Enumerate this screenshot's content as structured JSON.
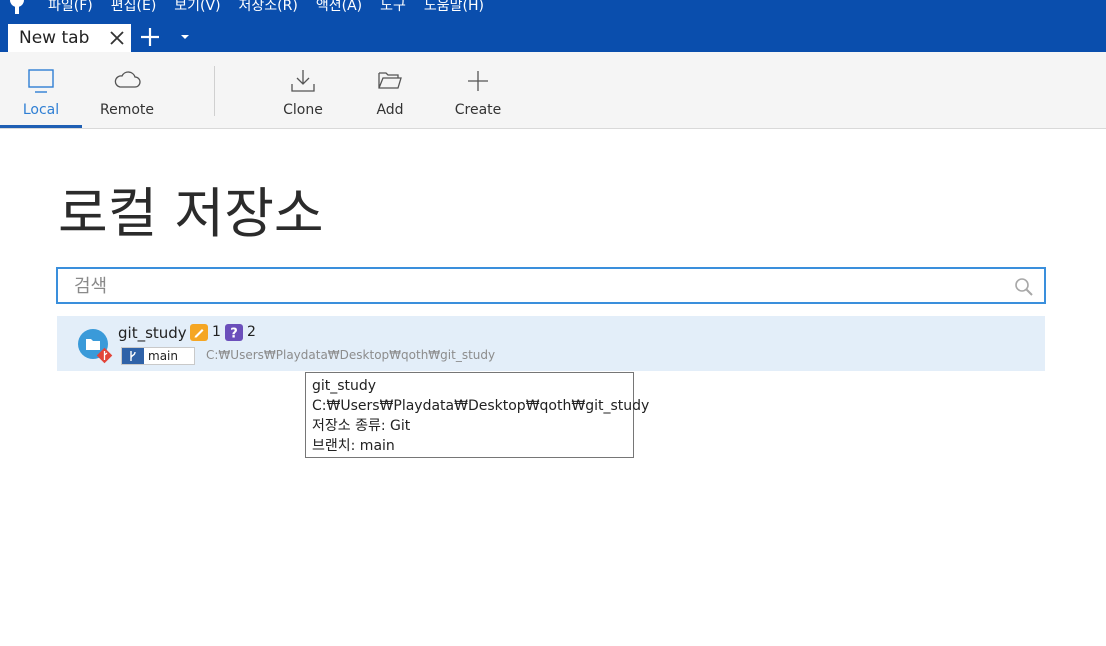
{
  "menubar": {
    "items": [
      "파일(F)",
      "편집(E)",
      "보기(V)",
      "저장소(R)",
      "액션(A)",
      "도구",
      "도움말(H)"
    ]
  },
  "tabs": {
    "active_label": "New tab"
  },
  "toolbar": {
    "local": "Local",
    "remote": "Remote",
    "clone": "Clone",
    "add": "Add",
    "create": "Create"
  },
  "page": {
    "title": "로컬 저장소"
  },
  "search": {
    "placeholder": "검색",
    "value": ""
  },
  "repositories": [
    {
      "name": "git_study",
      "modified_count": "1",
      "untracked_count": "2",
      "branch": "main",
      "path": "C:₩Users₩Playdata₩Desktop₩qoth₩git_study"
    }
  ],
  "tooltip": {
    "lines": [
      "git_study",
      "C:₩Users₩Playdata₩Desktop₩qoth₩git_study",
      "저장소 종류: Git",
      "브랜치: main"
    ]
  },
  "colors": {
    "brand_blue": "#0a4ead",
    "accent_blue": "#2f7fd4",
    "selected_row": "#e3eef9",
    "modified_badge": "#f5a623",
    "untracked_badge": "#6b4fbb",
    "git_red": "#e2453a"
  },
  "icons": {
    "logo": "sourcetree-logo-icon",
    "tab_close": "close-icon",
    "tab_add": "plus-icon",
    "tab_more": "chevron-down-icon",
    "local": "monitor-icon",
    "remote": "cloud-icon",
    "clone": "download-icon",
    "add": "folder-open-icon",
    "create": "plus-icon",
    "search": "search-icon",
    "repo": "folder-icon",
    "branch": "branch-icon"
  }
}
